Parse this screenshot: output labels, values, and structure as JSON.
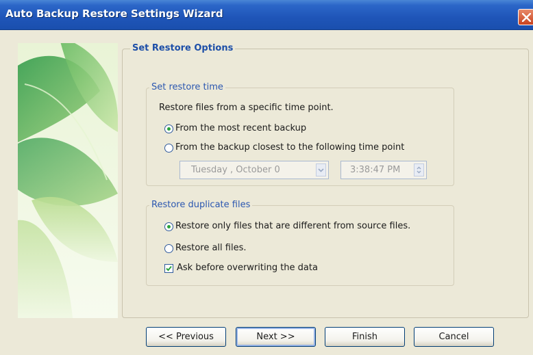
{
  "window": {
    "title": "Auto Backup Restore Settings Wizard"
  },
  "page": {
    "section_title": "Set Restore Options"
  },
  "restore_time": {
    "group_label": "Set restore time",
    "description": "Restore files from a specific time point.",
    "option_recent": "From the most recent backup",
    "option_time_point": "From the backup closest to the following time point",
    "selected": "option_recent",
    "date_value": "Tuesday ,  October  0",
    "time_value": "3:38:47 PM",
    "controls_enabled": false
  },
  "duplicate_files": {
    "group_label": "Restore duplicate files",
    "option_different": "Restore only files that are different from source files.",
    "option_all": "Restore all files.",
    "selected": "option_different",
    "ask_before_overwrite_label": "Ask before overwriting the data",
    "ask_before_overwrite_checked": true
  },
  "buttons": {
    "previous": "<< Previous",
    "next": "Next >>",
    "finish": "Finish",
    "cancel": "Cancel"
  },
  "icons": {
    "close": "close-icon",
    "dropdown": "chevron-down-icon",
    "spinner": "spinner-arrows-icon",
    "checkmark": "checkmark-icon"
  },
  "colors": {
    "title_bar": "#1f55b8",
    "section_title": "#1d4fa8",
    "group_label": "#2b57b0",
    "window_bg": "#ece9d8",
    "radio_dot": "#2aa33b"
  }
}
